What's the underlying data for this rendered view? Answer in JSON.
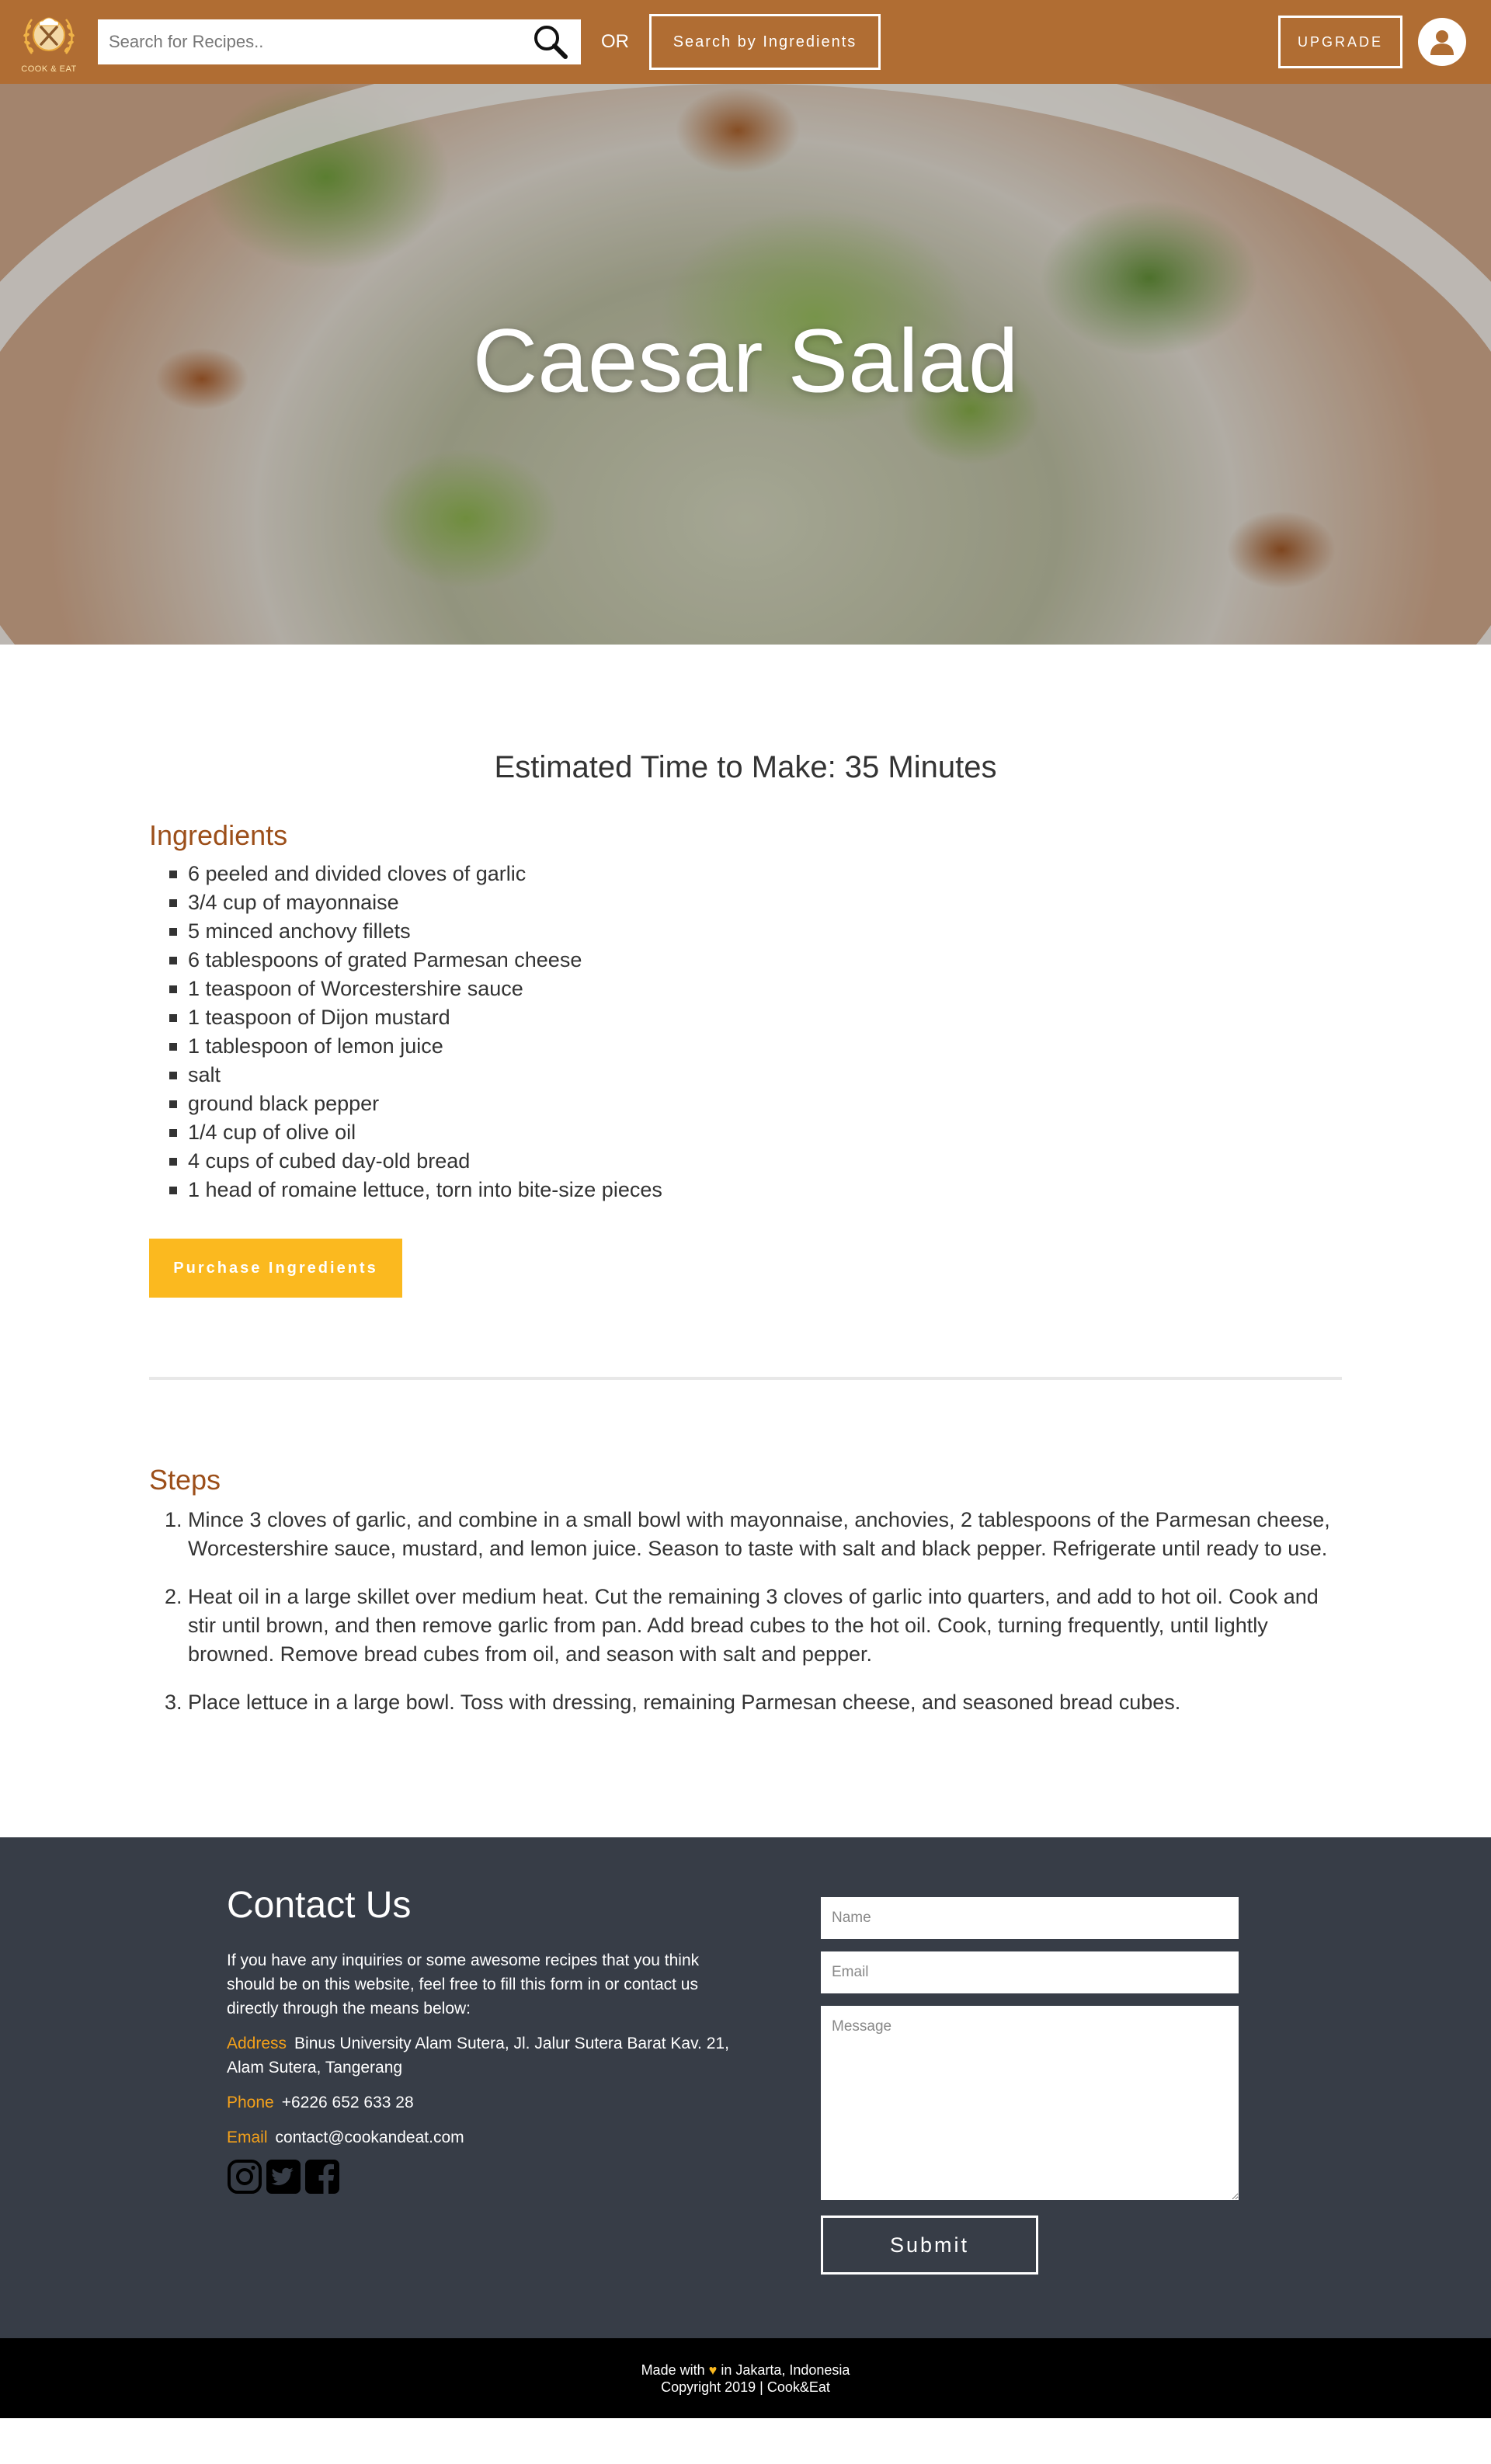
{
  "header": {
    "logo_text": "COOK & EAT",
    "search_placeholder": "Search for Recipes..",
    "or_label": "OR",
    "search_by_ingredients_label": "Search by Ingredients",
    "upgrade_label": "UPGRADE"
  },
  "hero": {
    "title": "Caesar Salad"
  },
  "recipe": {
    "estimated_time": "Estimated Time to Make: 35 Minutes",
    "ingredients_title": "Ingredients",
    "ingredients": [
      "6 peeled and divided cloves of garlic",
      "3/4 cup of mayonnaise",
      "5 minced anchovy fillets",
      "6 tablespoons of grated Parmesan cheese",
      "1 teaspoon of Worcestershire sauce",
      "1 teaspoon of Dijon mustard",
      "1 tablespoon of lemon juice",
      "salt",
      "ground black pepper",
      "1/4 cup of olive oil",
      "4 cups of cubed day-old bread",
      "1 head of romaine lettuce, torn into bite-size pieces"
    ],
    "purchase_label": "Purchase Ingredients",
    "steps_title": "Steps",
    "steps": [
      "Mince 3 cloves of garlic, and combine in a small bowl with mayonnaise, anchovies, 2 tablespoons of the Parmesan cheese, Worcestershire sauce, mustard, and lemon juice. Season to taste with salt and black pepper. Refrigerate until ready to use.",
      "Heat oil in a large skillet over medium heat. Cut the remaining 3 cloves of garlic into quarters, and add to hot oil. Cook and stir until brown, and then remove garlic from pan. Add bread cubes to the hot oil. Cook, turning frequently, until lightly browned. Remove bread cubes from oil, and season with salt and pepper.",
      "Place lettuce in a large bowl. Toss with dressing, remaining Parmesan cheese, and seasoned bread cubes."
    ]
  },
  "contact": {
    "heading": "Contact Us",
    "description": "If you have any inquiries or some awesome recipes that you think should be on this website, feel free to fill this form in or contact us directly through the means below:",
    "address_label": "Address",
    "address_value": "Binus University Alam Sutera, Jl. Jalur Sutera Barat Kav. 21, Alam Sutera, Tangerang",
    "phone_label": "Phone",
    "phone_value": "+6226 652 633 28",
    "email_label": "Email",
    "email_value": "contact@cookandeat.com",
    "social_icons": [
      "instagram-icon",
      "twitter-icon",
      "facebook-icon"
    ],
    "form": {
      "name_placeholder": "Name",
      "email_placeholder": "Email",
      "message_placeholder": "Message",
      "submit_label": "Submit"
    }
  },
  "footer": {
    "made_with_prefix": "Made with",
    "made_with_suffix": "in Jakarta, Indonesia",
    "copyright": "Copyright 2019 | Cook&Eat"
  },
  "colors": {
    "header_bg": "#b06d33",
    "accent_orange": "#9c4f1a",
    "button_yellow": "#fbb91f",
    "contact_bg": "#373d47",
    "contact_label": "#f4a11a",
    "footer_bg": "#000000"
  }
}
